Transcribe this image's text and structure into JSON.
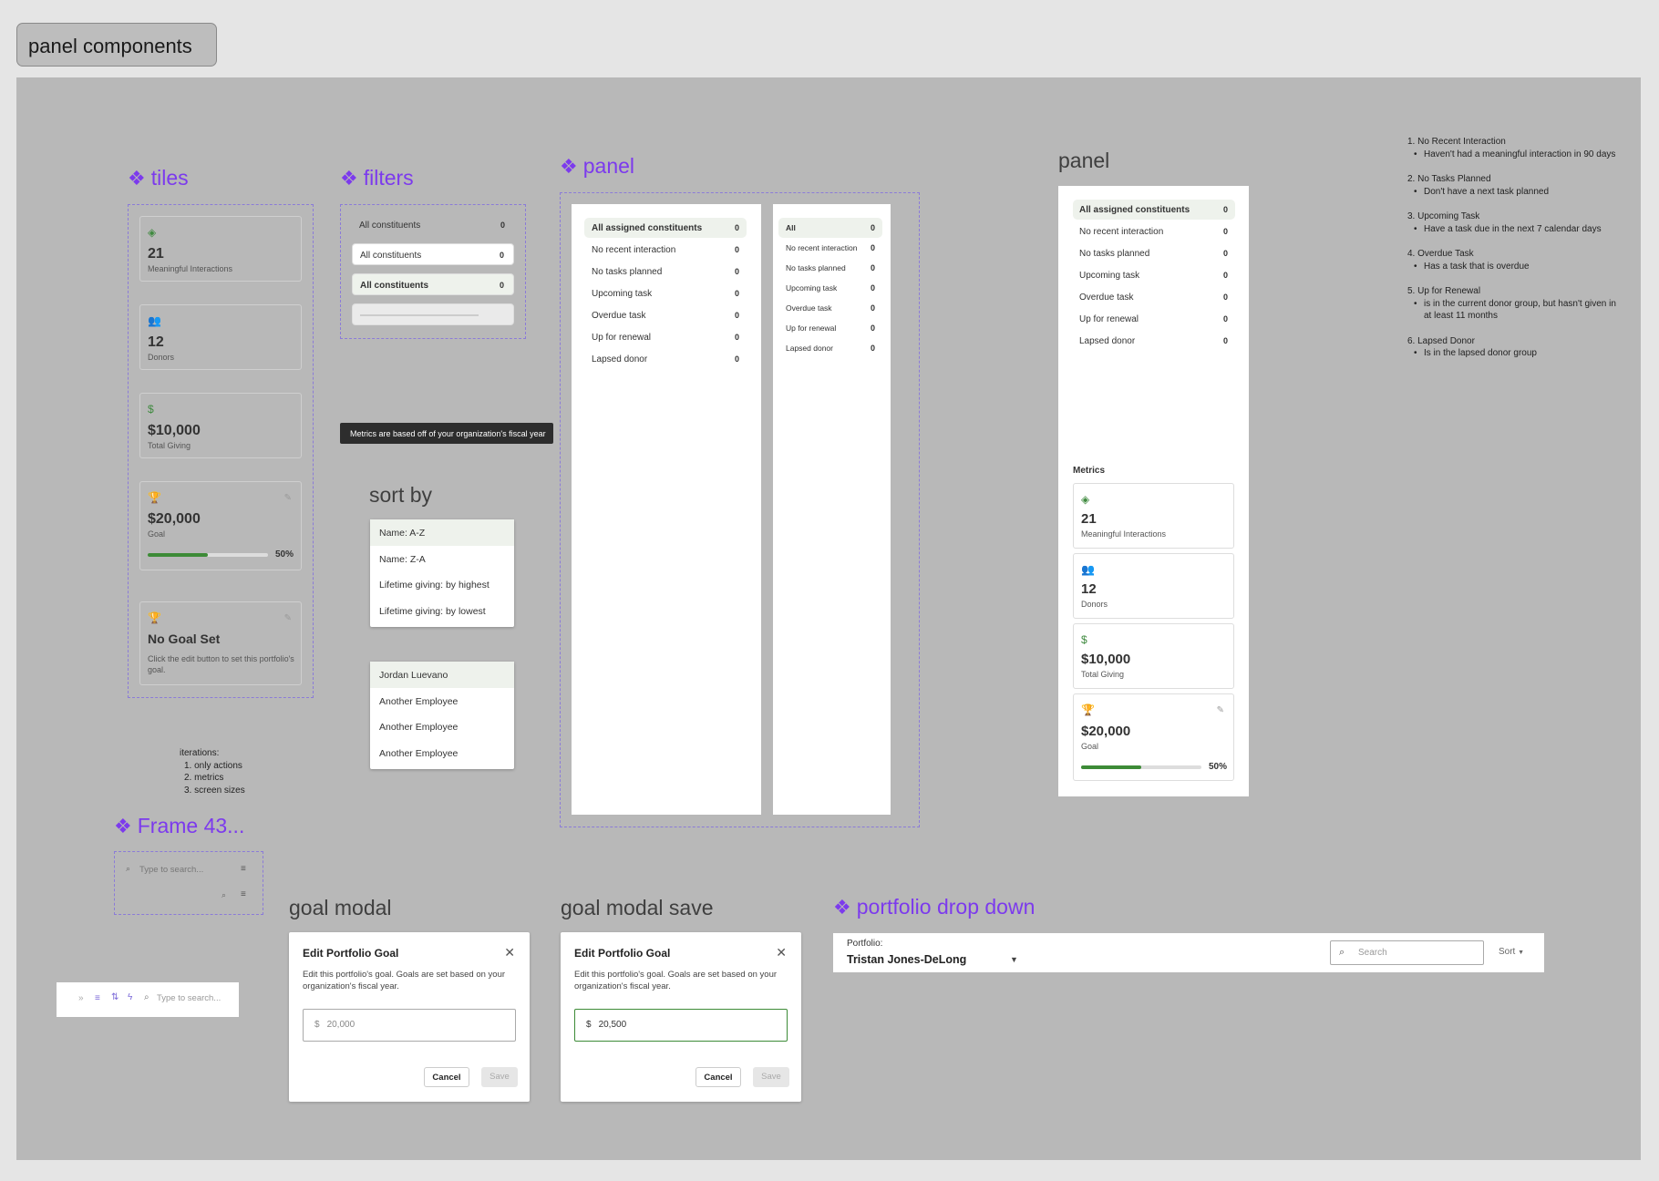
{
  "page_title": "panel components",
  "tiles": {
    "title": "tiles",
    "meaningful": {
      "icon": "handshake-icon",
      "value": "21",
      "label": "Meaningful Interactions"
    },
    "donors": {
      "icon": "people-icon",
      "value": "12",
      "label": "Donors"
    },
    "giving": {
      "icon": "dollar-icon",
      "symbol": "$",
      "value": "$10,000",
      "label": "Total Giving"
    },
    "goal": {
      "icon": "trophy-icon",
      "value": "$20,000",
      "label": "Goal",
      "progress": 0.5,
      "percent": "50%"
    },
    "no_goal": {
      "icon": "trophy-icon",
      "title": "No Goal Set",
      "desc": "Click the edit button to set this portfolio's goal."
    }
  },
  "filters": {
    "title": "filters",
    "rows": [
      {
        "label": "All constituents",
        "count": "0"
      },
      {
        "label": "All constituents",
        "count": "0"
      },
      {
        "label": "All constituents",
        "count": "0"
      }
    ]
  },
  "tooltip": "Metrics are based off of your organization's fiscal year",
  "sort_by": {
    "title": "sort by",
    "options": [
      "Name: A-Z",
      "Name: Z-A",
      "Lifetime giving: by highest",
      "Lifetime giving: by lowest"
    ]
  },
  "employees": [
    "Jordan Luevano",
    "Another Employee",
    "Another Employee",
    "Another Employee"
  ],
  "iterations": {
    "heading": "iterations:",
    "items": [
      "1.  only actions",
      "2.  metrics",
      "3.  screen sizes"
    ]
  },
  "panel_component": {
    "title": "panel",
    "wide": [
      {
        "label": "All assigned constituents",
        "count": "0"
      },
      {
        "label": "No recent interaction",
        "count": "0"
      },
      {
        "label": "No tasks planned",
        "count": "0"
      },
      {
        "label": "Upcoming task",
        "count": "0"
      },
      {
        "label": "Overdue task",
        "count": "0"
      },
      {
        "label": "Up for renewal",
        "count": "0"
      },
      {
        "label": "Lapsed donor",
        "count": "0"
      }
    ],
    "narrow": [
      {
        "label": "All",
        "count": "0"
      },
      {
        "label": "No recent interaction",
        "count": "0"
      },
      {
        "label": "No tasks planned",
        "count": "0"
      },
      {
        "label": "Upcoming task",
        "count": "0"
      },
      {
        "label": "Overdue task",
        "count": "0"
      },
      {
        "label": "Up for renewal",
        "count": "0"
      },
      {
        "label": "Lapsed donor",
        "count": "0"
      }
    ]
  },
  "panel_frame": {
    "title": "panel",
    "rows": [
      {
        "label": "All assigned constituents",
        "count": "0"
      },
      {
        "label": "No recent interaction",
        "count": "0"
      },
      {
        "label": "No tasks planned",
        "count": "0"
      },
      {
        "label": "Upcoming task",
        "count": "0"
      },
      {
        "label": "Overdue task",
        "count": "0"
      },
      {
        "label": "Up for renewal",
        "count": "0"
      },
      {
        "label": "Lapsed donor",
        "count": "0"
      }
    ],
    "metrics_label": "Metrics",
    "metrics": {
      "meaningful": {
        "value": "21",
        "label": "Meaningful Interactions"
      },
      "donors": {
        "value": "12",
        "label": "Donors"
      },
      "giving": {
        "symbol": "$",
        "value": "$10,000",
        "label": "Total Giving"
      },
      "goal": {
        "value": "$20,000",
        "label": "Goal",
        "progress": 0.5,
        "percent": "50%"
      }
    }
  },
  "notes": [
    {
      "title": "1. No Recent Interaction",
      "bullets": [
        "Haven't had a meaningful interaction in 90 days"
      ]
    },
    {
      "title": "2. No Tasks Planned",
      "bullets": [
        "Don't have a next task planned"
      ]
    },
    {
      "title": "3. Upcoming Task",
      "bullets": [
        "Have a task due in the next 7 calendar days"
      ]
    },
    {
      "title": "4. Overdue Task",
      "bullets": [
        "Has a task that is overdue"
      ]
    },
    {
      "title": "5. Up for Renewal",
      "bullets": [
        "is in the current donor group, but hasn't given in at least 11 months"
      ]
    },
    {
      "title": "6. Lapsed Donor",
      "bullets": [
        "Is in the lapsed donor group"
      ]
    }
  ],
  "frame43": {
    "title": "Frame 43...",
    "search_placeholder": "Type to search..."
  },
  "toolbar": {
    "search_placeholder": "Type to search..."
  },
  "goal_modal": {
    "frame_title": "goal modal",
    "title": "Edit Portfolio Goal",
    "desc": "Edit this portfolio's goal. Goals are set based on your organization's fiscal year.",
    "currency": "$",
    "value": "20,000",
    "cancel": "Cancel",
    "save": "Save"
  },
  "goal_modal_save": {
    "frame_title": "goal modal save",
    "title": "Edit Portfolio Goal",
    "desc": "Edit this portfolio's goal. Goals are set based on your organization's fiscal year.",
    "currency": "$",
    "value": "20,500",
    "cancel": "Cancel",
    "save": "Save"
  },
  "portfolio_dropdown": {
    "title": "portfolio drop down",
    "label": "Portfolio:",
    "value": "Tristan Jones-DeLong",
    "search_placeholder": "Search",
    "sort_label": "Sort"
  },
  "colors": {
    "accent": "#7c3aed",
    "green": "#3d8b37",
    "canvas": "#b8b8b8"
  }
}
